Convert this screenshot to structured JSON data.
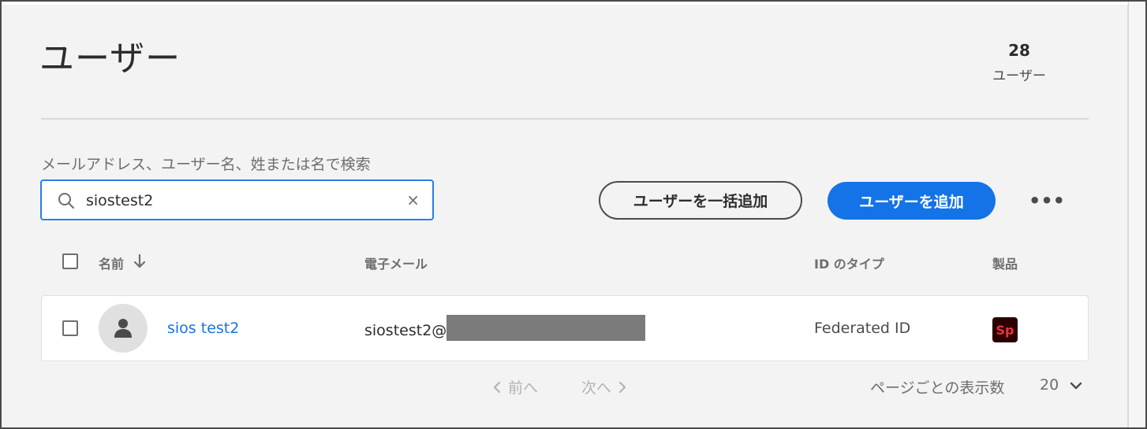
{
  "header": {
    "title": "ユーザー",
    "count": "28",
    "count_label": "ユーザー"
  },
  "search": {
    "label": "メールアドレス、ユーザー名、姓または名で検索",
    "value": "siostest2",
    "clear_icon": "close-icon"
  },
  "toolbar": {
    "bulk_add_label": "ユーザーを一括追加",
    "add_user_label": "ユーザーを追加",
    "more_icon": "ellipsis-icon",
    "primary_color": "#1473e6"
  },
  "table": {
    "columns": [
      "名前",
      "電子メール",
      "ID のタイプ",
      "製品"
    ],
    "sort_column": "名前",
    "sort_direction": "descending",
    "rows": [
      {
        "name": "sios test2",
        "email_visible": "siostest2@",
        "email_redacted": true,
        "id_type": "Federated ID",
        "product_icon_text": "Sp",
        "product_icon_color": "#e8343f"
      }
    ]
  },
  "pagination": {
    "prev_label": "前へ",
    "next_label": "次へ",
    "per_page_label": "ページごとの表示数",
    "per_page_value": "20"
  }
}
